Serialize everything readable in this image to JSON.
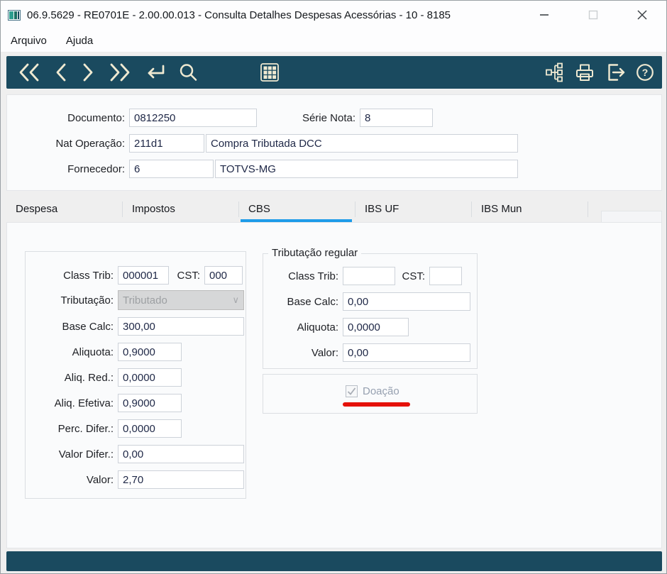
{
  "window": {
    "title": "06.9.5629 - RE0701E - 2.00.00.013 - Consulta Detalhes Despesas Acessórias - 10 - 8185"
  },
  "menu": {
    "items": [
      {
        "label": "Arquivo"
      },
      {
        "label": "Ajuda"
      }
    ]
  },
  "toolbar": {
    "icons": [
      "first-record",
      "previous-record",
      "next-record",
      "last-record",
      "enter-confirm",
      "search",
      "grid-browse",
      "related-tree",
      "print",
      "exit",
      "help"
    ]
  },
  "header": {
    "documento_label": "Documento:",
    "documento_value": "0812250",
    "serie_label": "Série Nota:",
    "serie_value": "8",
    "natop_label": "Nat Operação:",
    "natop_code": "211d1",
    "natop_desc": "Compra Tributada DCC",
    "fornecedor_label": "Fornecedor:",
    "fornecedor_code": "6",
    "fornecedor_desc": "TOTVS-MG"
  },
  "tabs": {
    "items": [
      {
        "label": "Despesa"
      },
      {
        "label": "Impostos"
      },
      {
        "label": "CBS"
      },
      {
        "label": "IBS UF"
      },
      {
        "label": "IBS Mun"
      }
    ],
    "active": "CBS"
  },
  "cbs": {
    "class_trib_label": "Class Trib:",
    "class_trib_value": "000001",
    "cst_label": "CST:",
    "cst_value": "000",
    "tributacao_label": "Tributação:",
    "tributacao_value": "Tributado",
    "base_calc_label": "Base Calc:",
    "base_calc_value": "300,00",
    "aliquota_label": "Aliquota:",
    "aliquota_value": "0,9000",
    "aliq_red_label": "Aliq. Red.:",
    "aliq_red_value": "0,0000",
    "aliq_efetiva_label": "Aliq. Efetiva:",
    "aliq_efetiva_value": "0,9000",
    "perc_difer_label": "Perc. Difer.:",
    "perc_difer_value": "0,0000",
    "valor_difer_label": "Valor Difer.:",
    "valor_difer_value": "0,00",
    "valor_label": "Valor:",
    "valor_value": "2,70",
    "regular": {
      "title": "Tributação regular",
      "class_trib_label": "Class Trib:",
      "class_trib_value": "",
      "cst_label": "CST:",
      "cst_value": "",
      "base_calc_label": "Base Calc:",
      "base_calc_value": "0,00",
      "aliquota_label": "Aliquota:",
      "aliquota_value": "0,0000",
      "valor_label": "Valor:",
      "valor_value": "0,00"
    },
    "doacao": {
      "label": "Doação",
      "checked": true
    }
  },
  "colors": {
    "toolbar_bg": "#1a4a5f",
    "icon": "#efe9d1",
    "tab_active_underline": "#1e9ce9",
    "annotation_red": "#e51109"
  }
}
